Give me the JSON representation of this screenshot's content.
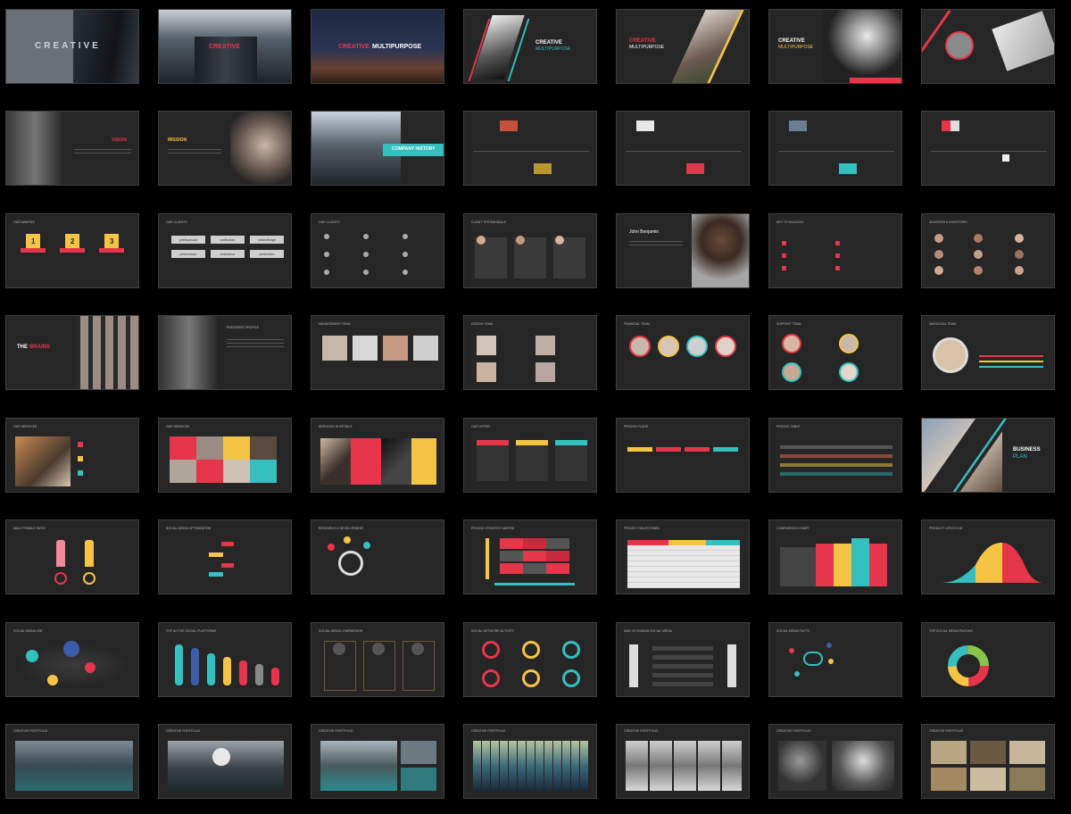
{
  "slides": {
    "r1c1": {
      "title": "CREATIVE"
    },
    "r1c2": {
      "title": "CREATIVE"
    },
    "r1c3": {
      "title_a": "CREATIVE",
      "title_b": "MULTIPURPOSE"
    },
    "r1c4": {
      "title_a": "CREATIVE",
      "title_b": "MULTIPURPOSE"
    },
    "r1c5": {
      "title_a": "CREATIVE",
      "title_b": "MULTIPURPOSE"
    },
    "r1c6": {
      "title_a": "CREATIVE",
      "title_b": "MULTIPURPOSE"
    },
    "r2c1": {
      "title": "VISION"
    },
    "r2c2": {
      "title": "MISSION"
    },
    "r2c3": {
      "title": "COMPANY HISTORY"
    },
    "r3c1": {
      "title": "OUR AWARDS",
      "ranks": [
        "1",
        "2",
        "3"
      ]
    },
    "r3c2": {
      "title": "OUR CLIENTS",
      "logos": [
        "prettyshoot",
        "collection",
        "codedesign",
        "photodune",
        "videohive",
        "activeden"
      ]
    },
    "r3c3": {
      "title": "OUR CLIENTS"
    },
    "r3c4": {
      "title": "CLIENT TESTIMONIALS"
    },
    "r3c5": {
      "name": "John Benjamin"
    },
    "r3c6": {
      "title": "KEY TO SUCCESS"
    },
    "r3c7": {
      "title": "ADVISORS & INVESTORS"
    },
    "r4c1": {
      "title_a": "THE",
      "title_b": "BRAINS"
    },
    "r4c2": {
      "title": "PRESIDENT PROFILE"
    },
    "r4c3": {
      "title": "MANAGEMENT TEAM"
    },
    "r4c4": {
      "title": "DESIGN TEAM"
    },
    "r4c5": {
      "title": "FINANCIAL TEAM"
    },
    "r4c6": {
      "title": "SUPPORT TEAM"
    },
    "r4c7": {
      "title": "INDIVIDUAL TEAM"
    },
    "r5c1": {
      "title": "OUR SERVICES"
    },
    "r5c2": {
      "title": "OUR SERVICES"
    },
    "r5c3": {
      "title": "SERVICES IN DETAILS"
    },
    "r5c4": {
      "title": "OUR OFFER"
    },
    "r5c5": {
      "title": "PRICING PLANS"
    },
    "r5c6": {
      "title": "PRICING TABLE"
    },
    "r5c7": {
      "title_a": "BUSINESS",
      "title_b": "PLAN"
    },
    "r6c1": {
      "title": "MALE FEMALE RATIO"
    },
    "r6c2": {
      "title": "SOCIAL MEDIA OPTIMIZATION"
    },
    "r6c3": {
      "title": "RESEARCH & DEVELOPMENT"
    },
    "r6c4": {
      "title": "PRICING STRATEGY MATRIX"
    },
    "r6c5": {
      "title": "PROJECT MILESTONES"
    },
    "r6c6": {
      "title": "COMPARISON CHART"
    },
    "r6c7": {
      "title": "PRODUCT LIFECYCLE"
    },
    "r7c1": {
      "title": "SOCIAL MEDIA USE"
    },
    "r7c2": {
      "title": "TOP ACTIVE SOCIAL PLATFORMS"
    },
    "r7c3": {
      "title": "SOCIAL MEDIA COMPARISON"
    },
    "r7c4": {
      "title": "SOCIAL NETWORK ACTIVITY"
    },
    "r7c5": {
      "title": "MAN VS WOMAN SOCIAL MEDIA"
    },
    "r7c6": {
      "title": "SOCIAL MEDIA FACTS"
    },
    "r7c7": {
      "title": "TOP SOCIAL MEDIA PACKING"
    },
    "r8c1": {
      "title": "CREATIVE PORTFOLIO"
    },
    "r8c2": {
      "title": "CREATIVE PORTFOLIO"
    },
    "r8c3": {
      "title": "CREATIVE PORTFOLIO"
    },
    "r8c4": {
      "title": "CREATIVE PORTFOLIO"
    },
    "r8c5": {
      "title": "CREATIVE PORTFOLIO"
    },
    "r8c6": {
      "title": "CREATIVE PORTFOLIO"
    },
    "r8c7": {
      "title": "CREATIVE PORTFOLIO"
    }
  },
  "colors": {
    "red": "#e5364b",
    "teal": "#35bfbf",
    "yellow": "#f5c445",
    "dark": "#262626"
  }
}
